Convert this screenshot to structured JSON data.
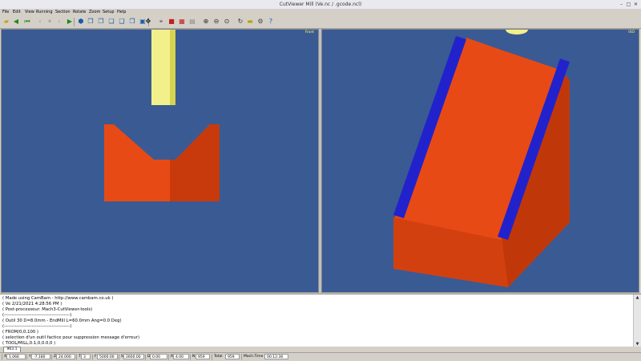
{
  "window": {
    "title": "CutViewer Mill (Ve.nc / .gcode.ncl)"
  },
  "menu": [
    "File",
    "Edit",
    "View",
    "Running",
    "Section",
    "Rotate",
    "Zoom",
    "Setup",
    "Help"
  ],
  "views": {
    "left_label": "Front",
    "right_label": "ISO"
  },
  "gcode": {
    "lines": [
      "( Made using CamBam - http://www.cambam.co.uk )",
      "( Ve 2/21/2021 4:28:56 PM )",
      "( Post-processeur: Mach3-CutViewer-tools)",
      "(-------------------------------------------)",
      "( Outil 30 D=8.0mm - EndMill L=60.0mm Ang=0.0 Deg)",
      "(-------------------------------------------)",
      "( FROM/0,0,100 )",
      "( selection d'un outil factice pour suppression message d'erreur)",
      "( TOOL/MILL,0.1,0,0.0,0 )"
    ],
    "line_number": "963.1"
  },
  "status": {
    "x_label": "X",
    "x": "1.066",
    "y_label": "Y",
    "y": "-7.180",
    "z_label": "Z",
    "z": "24.000",
    "t_label": "T",
    "t": "3",
    "f_label": "F",
    "f": "5000.00",
    "s_label": "S",
    "s": "2600.00",
    "d_label": "D",
    "d": "0.00",
    "r_label": "R",
    "r": "4.00",
    "n_label": "N",
    "n": "959",
    "total_label": "Total",
    "total": "959",
    "mach_label": "Mach.Time",
    "mach_time": "00:12:36"
  }
}
